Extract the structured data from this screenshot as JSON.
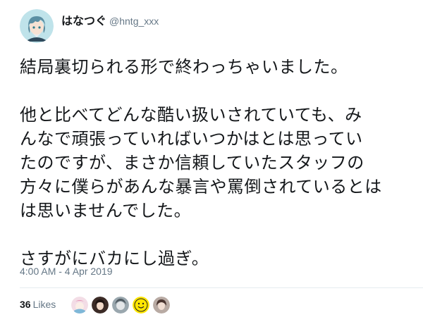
{
  "user": {
    "display_name": "はなつぐ",
    "handle": "@hntg_xxx"
  },
  "tweet": {
    "lines": [
      "結局裏切られる形で終わっちゃいました。",
      "他と比べてどんな酷い扱いされていても、み",
      "んなで頑張っていればいつかはとは思ってい",
      "たのですが、まさか信頼していたスタッフの",
      "方々に僕らがあんな暴言や罵倒されているとは",
      "は思いませんでした。",
      "さすがにバカにし過ぎ。"
    ],
    "timestamp": "4:00 AM - 4 Apr 2019"
  },
  "stats": {
    "likes_count": "36",
    "likes_label": "Likes"
  },
  "colors": {
    "text_primary": "#14171a",
    "text_secondary": "#657786",
    "divider": "#e6ecf0"
  }
}
